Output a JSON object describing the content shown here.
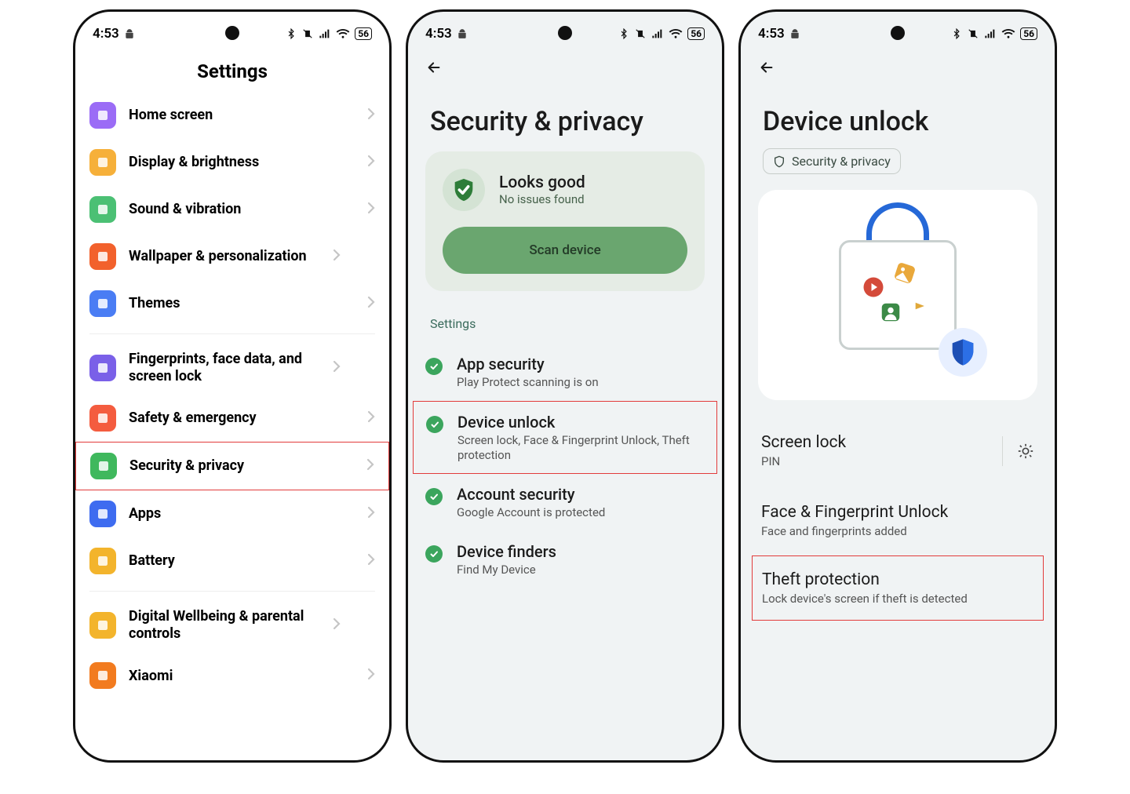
{
  "status": {
    "time": "4:53",
    "battery": "56"
  },
  "phone1": {
    "title": "Settings",
    "items": [
      {
        "name": "home-screen",
        "label": "Home screen",
        "color": "#9b6cf6"
      },
      {
        "name": "display",
        "label": "Display & brightness",
        "color": "#f6b03a"
      },
      {
        "name": "sound",
        "label": "Sound & vibration",
        "color": "#4bc074"
      },
      {
        "name": "wallpaper",
        "label": "Wallpaper & personalization",
        "color": "#f2612c",
        "wrap": true
      },
      {
        "name": "themes",
        "label": "Themes",
        "color": "#4a7df4"
      },
      {
        "name": "SEP"
      },
      {
        "name": "biometrics",
        "label": "Fingerprints, face data, and screen lock",
        "color": "#7a60e8",
        "wrap": true
      },
      {
        "name": "safety",
        "label": "Safety & emergency",
        "color": "#f45c3f"
      },
      {
        "name": "security",
        "label": "Security & privacy",
        "color": "#3fb85d",
        "highlight": true
      },
      {
        "name": "apps",
        "label": "Apps",
        "color": "#3e6cf0"
      },
      {
        "name": "battery",
        "label": "Battery",
        "color": "#f3b42c"
      },
      {
        "name": "SEP"
      },
      {
        "name": "wellbeing",
        "label": "Digital Wellbeing & parental controls",
        "color": "#f3b42c",
        "wrap": true
      },
      {
        "name": "xiaomi",
        "label": "Xiaomi",
        "color": "#f27b1f"
      }
    ]
  },
  "phone2": {
    "title": "Security & privacy",
    "card": {
      "headline": "Looks good",
      "sub": "No issues found",
      "button": "Scan device"
    },
    "section_label": "Settings",
    "items": [
      {
        "name": "app-security",
        "title": "App security",
        "sub": "Play Protect scanning is on"
      },
      {
        "name": "device-unlock",
        "title": "Device unlock",
        "sub": "Screen lock, Face & Fingerprint Unlock, Theft protection",
        "highlight": true
      },
      {
        "name": "account-security",
        "title": "Account security",
        "sub": "Google Account is protected"
      },
      {
        "name": "device-finders",
        "title": "Device finders",
        "sub": "Find My Device"
      }
    ]
  },
  "phone3": {
    "title": "Device unlock",
    "breadcrumb": "Security & privacy",
    "rows": [
      {
        "name": "screen-lock",
        "title": "Screen lock",
        "sub": "PIN",
        "gear": true
      },
      {
        "name": "face-fingerprint",
        "title": "Face & Fingerprint Unlock",
        "sub": "Face and fingerprints added"
      },
      {
        "name": "theft-protection",
        "title": "Theft protection",
        "sub": "Lock device's screen if theft is detected",
        "highlight": true
      }
    ]
  }
}
